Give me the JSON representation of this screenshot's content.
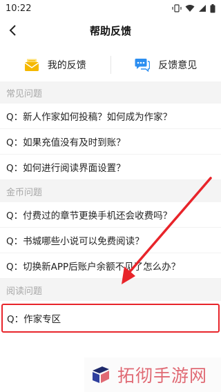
{
  "status_bar": {
    "time": "10:22"
  },
  "nav": {
    "title": "帮助反馈"
  },
  "actions": {
    "my_feedback": "我的反馈",
    "feedback_opinion": "反馈意见"
  },
  "sections": [
    {
      "title": "常见问题",
      "items": [
        "Q：新人作家如何投稿？如何成为作家？",
        "Q：如果充值没有及时到账？",
        "Q：如何进行阅读界面设置？"
      ]
    },
    {
      "title": "金币问题",
      "items": [
        "Q：付费过的章节更换手机还会收费吗？",
        "Q：书城哪些小说可以免费阅读？",
        "Q：切换新APP后账户余额不见了怎么办？"
      ]
    },
    {
      "title": "阅读问题",
      "items": [
        "Q：作家专区"
      ]
    }
  ],
  "watermark": {
    "text": "拓彻手游网"
  },
  "colors": {
    "highlight": "#e8242a",
    "accent_yellow": "#f5b800",
    "accent_blue": "#2c8ef0"
  }
}
